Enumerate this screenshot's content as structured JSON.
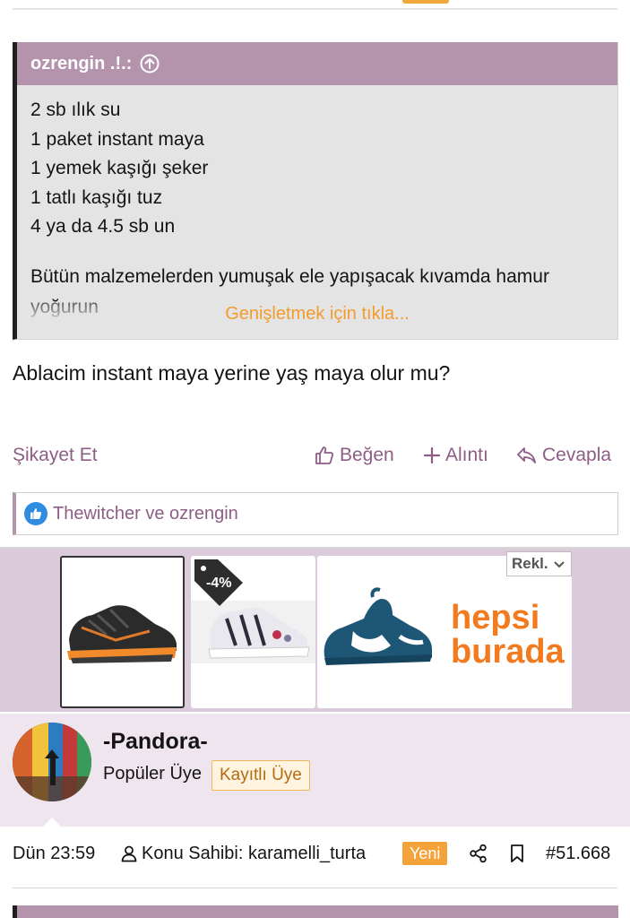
{
  "quote": {
    "author": "ozrengin .!.:",
    "lines": [
      "2 sb ılık su",
      "1 paket instant maya",
      "1 yemek kaşığı şeker",
      "1 tatlı kaşığı tuz",
      "4 ya da 4.5 sb un"
    ],
    "paragraph": "Bütün malzemelerden yumuşak ele yapışacak kıvamda hamur",
    "paragraph_cont": "yoğurun",
    "expand_label": "Genişletmek için tıkla..."
  },
  "post": {
    "text": "Ablacim instant maya yerine yaş maya olur mu?"
  },
  "actions": {
    "report": "Şikayet Et",
    "like": "Beğen",
    "quote": "Alıntı",
    "reply": "Cevapla"
  },
  "likes": {
    "text": "Thewitcher ve ozrengin"
  },
  "ad": {
    "discount": "-4%",
    "brand_line1": "hepsi",
    "brand_line2": "burada",
    "rekl": "Rekl."
  },
  "user": {
    "name": "-Pandora-",
    "rank": "Popüler Üye",
    "badge": "Kayıtlı Üye"
  },
  "meta": {
    "time": "Dün 23:59",
    "starter": "Konu Sahibi: karamelli_turta",
    "new_badge": "Yeni",
    "post_number": "#51.668"
  },
  "colors": {
    "accent_purple": "#8e5d86",
    "quote_header": "#b493ad",
    "orange": "#f39c2c",
    "like_blue": "#2f8ce0"
  }
}
